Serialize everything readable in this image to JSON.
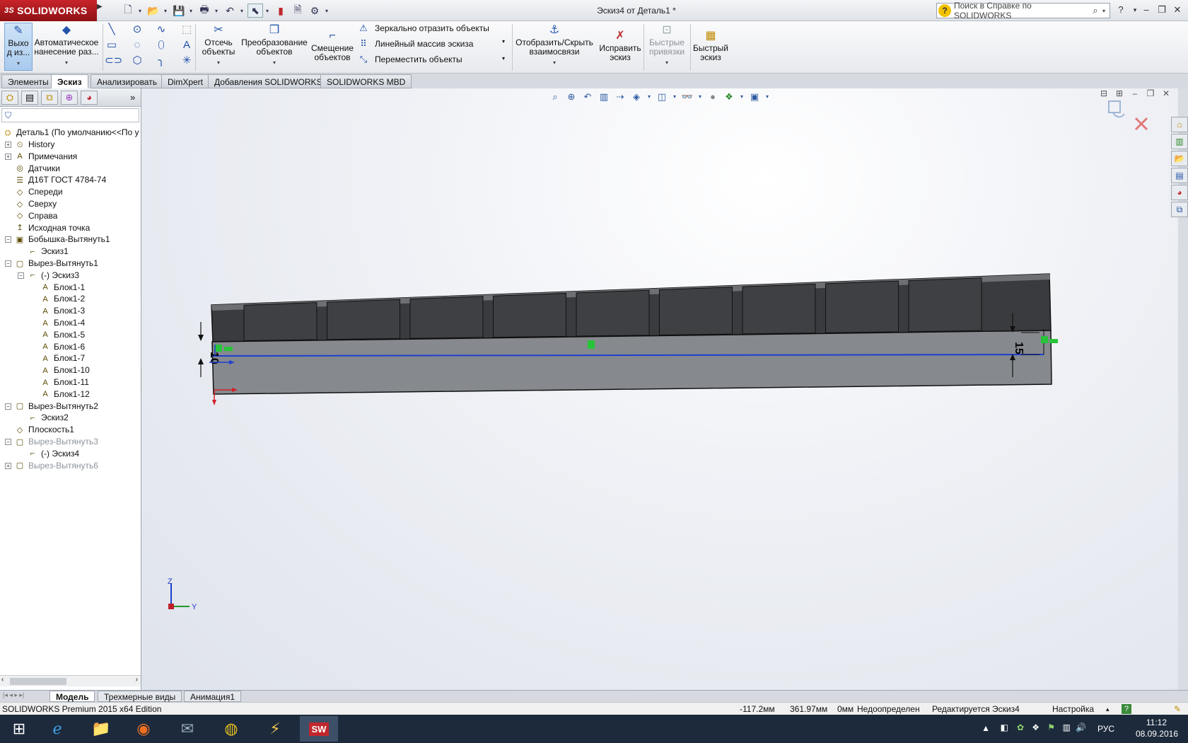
{
  "app": {
    "logo_brand": "SOLIDWORKS",
    "logo_ds": "3S",
    "doc_title": "Эскиз4 от Деталь1 *"
  },
  "help_search": {
    "placeholder": "Поиск в Справке по SOLIDWORKS"
  },
  "commands": {
    "exit_sketch": "Выхо д из...",
    "smart_dim": "Автоматическое нанесение раз...",
    "trim": "Отсечь объекты",
    "convert": "Преобразование объектов",
    "offset": "Смещение объектов",
    "mirror": "Зеркально отразить объекты",
    "linear_pattern": "Линейный массив эскиза",
    "move": "Переместить объекты",
    "show_hide_relations": "Отобразить/Скрыть взаимосвязи",
    "repair_sketch": "Исправить эскиз",
    "quick_snaps": "Быстрые привязки",
    "rapid_sketch": "Быстрый эскиз"
  },
  "ribbon_tabs": [
    "Элементы",
    "Эскиз",
    "Анализировать",
    "DimXpert",
    "Добавления SOLIDWORKS",
    "SOLIDWORKS MBD"
  ],
  "tree": {
    "root": "Деталь1  (По умолчанию<<По у",
    "items": [
      {
        "label": "History",
        "icon": "history-icon"
      },
      {
        "label": "Примечания",
        "icon": "annotations-icon"
      },
      {
        "label": "Датчики",
        "icon": "sensors-icon"
      },
      {
        "label": "Д16Т ГОСТ 4784-74",
        "icon": "material-icon"
      },
      {
        "label": "Спереди",
        "icon": "plane-icon"
      },
      {
        "label": "Сверху",
        "icon": "plane-icon"
      },
      {
        "label": "Справа",
        "icon": "plane-icon"
      },
      {
        "label": "Исходная точка",
        "icon": "origin-icon"
      },
      {
        "label": "Бобышка-Вытянуть1",
        "icon": "extrude-icon"
      },
      {
        "label": "Эскиз1",
        "icon": "sketch-icon"
      },
      {
        "label": "Вырез-Вытянуть1",
        "icon": "cut-icon"
      },
      {
        "label": "(-) Эскиз3",
        "icon": "sketch-icon"
      },
      {
        "label": "Блок1-1",
        "icon": "block-icon"
      },
      {
        "label": "Блок1-2",
        "icon": "block-icon"
      },
      {
        "label": "Блок1-3",
        "icon": "block-icon"
      },
      {
        "label": "Блок1-4",
        "icon": "block-icon"
      },
      {
        "label": "Блок1-5",
        "icon": "block-icon"
      },
      {
        "label": "Блок1-6",
        "icon": "block-icon"
      },
      {
        "label": "Блок1-7",
        "icon": "block-icon"
      },
      {
        "label": "Блок1-10",
        "icon": "block-icon"
      },
      {
        "label": "Блок1-11",
        "icon": "block-icon"
      },
      {
        "label": "Блок1-12",
        "icon": "block-icon"
      },
      {
        "label": "Вырез-Вытянуть2",
        "icon": "cut-icon"
      },
      {
        "label": "Эскиз2",
        "icon": "sketch-icon"
      },
      {
        "label": "Плоскость1",
        "icon": "plane-icon"
      },
      {
        "label": "Вырез-Вытянуть3",
        "icon": "cut-icon"
      },
      {
        "label": "(-) Эскиз4",
        "icon": "sketch-icon"
      },
      {
        "label": "Вырез-Вытянуть6",
        "icon": "cut-icon"
      }
    ]
  },
  "viewport": {
    "dim_left": "10",
    "dim_right": "15",
    "axis_z": "Z",
    "axis_y": "Y"
  },
  "bottom_tabs": [
    "Модель",
    "Трехмерные виды",
    "Анимация1"
  ],
  "status": {
    "edition": "SOLIDWORKS Premium 2015 x64 Edition",
    "x": "-117.2мм",
    "y": "361.97мм",
    "z": "0мм",
    "definition": "Недоопределен",
    "editing": "Редактируется Эскиз4",
    "units": "Настройка"
  },
  "tray": {
    "lang": "РУС",
    "time": "11:12",
    "date": "08.09.2016"
  },
  "colors": {
    "accent_red": "#b81c22",
    "sketch_blue": "#1f3fd0",
    "part_dark": "#3a3b3e",
    "part_face": "#86898e"
  }
}
